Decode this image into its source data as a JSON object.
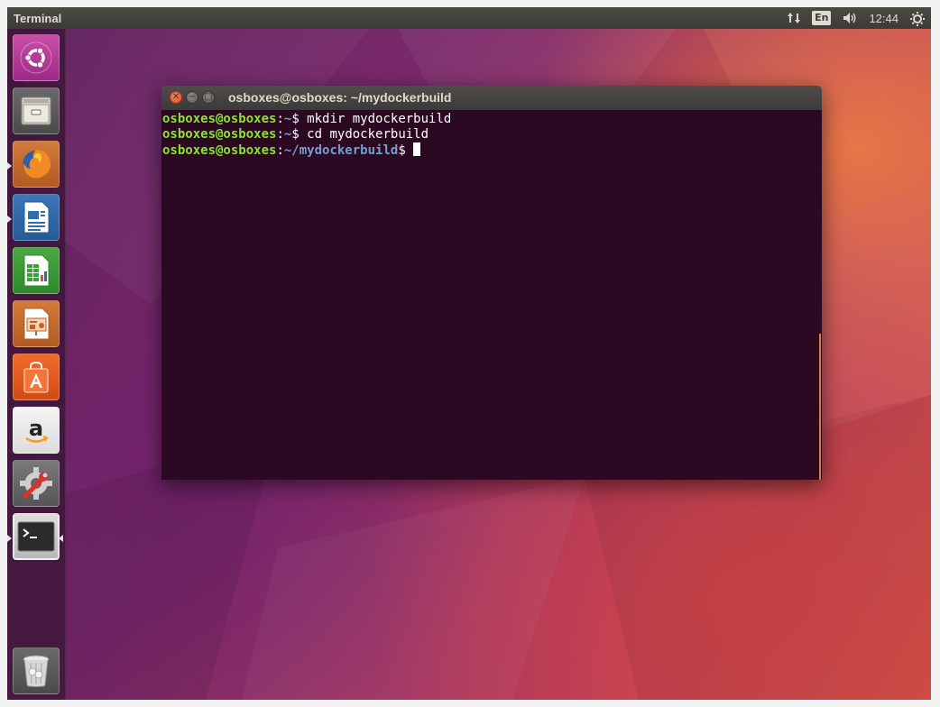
{
  "top_panel": {
    "app_title": "Terminal",
    "language": "En",
    "clock": "12:44"
  },
  "launcher": {
    "items": [
      {
        "name": "Dash",
        "icon": "ubuntu-logo-icon"
      },
      {
        "name": "Files",
        "icon": "file-cabinet-icon"
      },
      {
        "name": "Firefox Web Browser",
        "icon": "firefox-icon"
      },
      {
        "name": "LibreOffice Writer",
        "icon": "writer-icon"
      },
      {
        "name": "LibreOffice Calc",
        "icon": "calc-icon"
      },
      {
        "name": "LibreOffice Impress",
        "icon": "impress-icon"
      },
      {
        "name": "Ubuntu Software",
        "icon": "software-bag-icon"
      },
      {
        "name": "Amazon",
        "icon": "amazon-icon"
      },
      {
        "name": "System Settings",
        "icon": "settings-wrench-icon"
      },
      {
        "name": "Terminal",
        "icon": "terminal-icon"
      },
      {
        "name": "Trash",
        "icon": "trash-icon"
      }
    ]
  },
  "terminal": {
    "window_title": "osboxes@osboxes: ~/mydockerbuild",
    "lines": [
      {
        "user": "osboxes@osboxes",
        "path": "~",
        "command": "mkdir mydockerbuild"
      },
      {
        "user": "osboxes@osboxes",
        "path": "~",
        "command": "cd mydockerbuild"
      },
      {
        "user": "osboxes@osboxes",
        "path": "~/mydockerbuild",
        "command": ""
      }
    ]
  },
  "colors": {
    "prompt_user": "#8ae234",
    "prompt_path": "#729fcf",
    "terminal_bg": "#2c0922",
    "panel_bg": "#3c3b37"
  }
}
